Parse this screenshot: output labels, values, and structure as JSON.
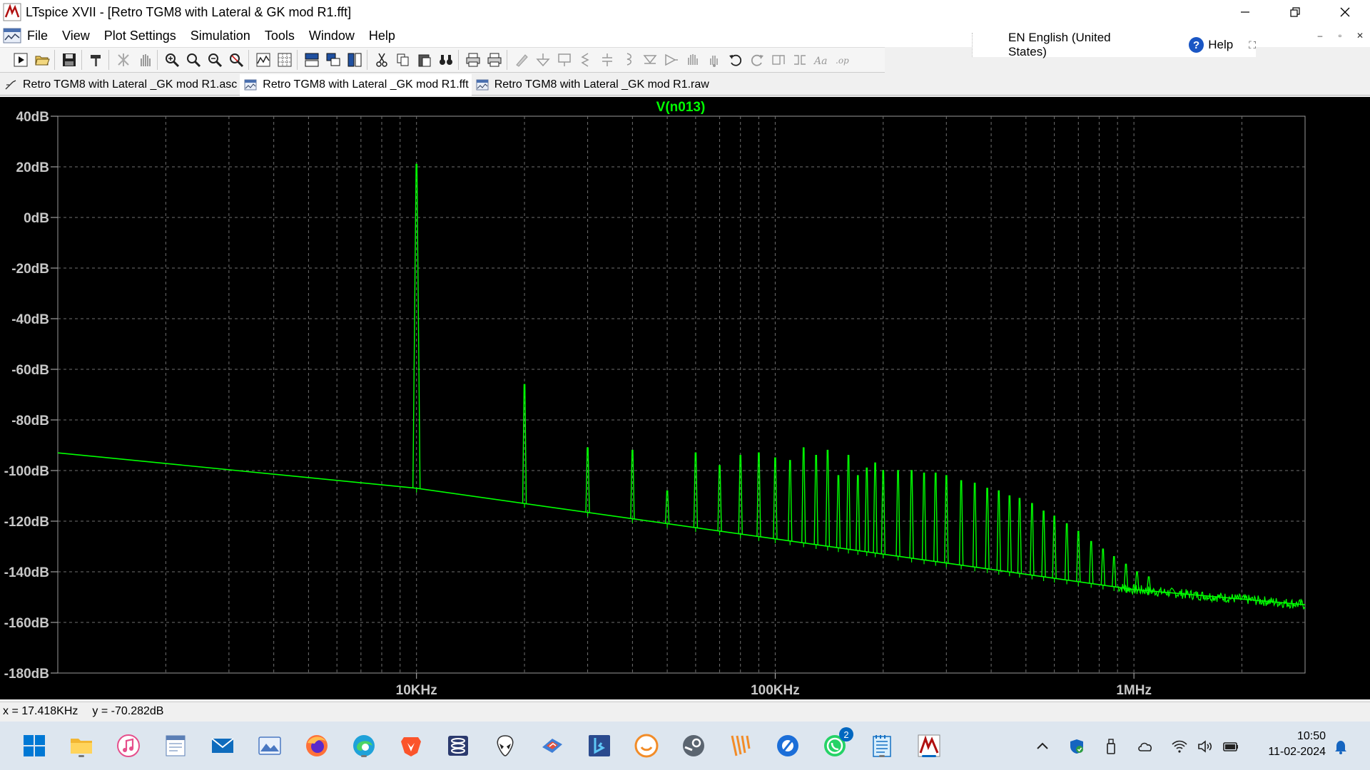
{
  "window": {
    "title": "LTspice XVII - [Retro TGM8 with Lateral & GK mod R1.fft]"
  },
  "menu": {
    "items": [
      "File",
      "View",
      "Plot Settings",
      "Simulation",
      "Tools",
      "Window",
      "Help"
    ]
  },
  "language_panel": {
    "language": "EN English (United States)",
    "help": "Help"
  },
  "tabs": [
    {
      "label": "Retro TGM8 with Lateral _GK mod R1.asc",
      "icon": "schematic-icon",
      "active": false
    },
    {
      "label": "Retro TGM8 with Lateral _GK mod R1.fft",
      "icon": "waveform-icon",
      "active": true
    },
    {
      "label": "Retro TGM8 with Lateral _GK mod R1.raw",
      "icon": "waveform-icon",
      "active": false
    }
  ],
  "status": {
    "x_readout": "x = 17.418KHz",
    "y_readout": "y = -70.282dB"
  },
  "clock": {
    "time": "10:50",
    "date": "11-02-2024"
  },
  "taskbar": {
    "whatsapp_badge": "2"
  },
  "chart_data": {
    "type": "line",
    "title": "V(n013)",
    "xlabel": "",
    "ylabel": "",
    "x_scale": "log",
    "xlim": [
      1000,
      3000000
    ],
    "ylim": [
      -180,
      40
    ],
    "x_ticks": [
      {
        "value": 10000,
        "label": "10KHz"
      },
      {
        "value": 100000,
        "label": "100KHz"
      },
      {
        "value": 1000000,
        "label": "1MHz"
      }
    ],
    "y_ticks": [
      {
        "value": 40,
        "label": "40dB"
      },
      {
        "value": 20,
        "label": "20dB"
      },
      {
        "value": 0,
        "label": "0dB"
      },
      {
        "value": -20,
        "label": "-20dB"
      },
      {
        "value": -40,
        "label": "-40dB"
      },
      {
        "value": -60,
        "label": "-60dB"
      },
      {
        "value": -80,
        "label": "-80dB"
      },
      {
        "value": -100,
        "label": "-100dB"
      },
      {
        "value": -120,
        "label": "-120dB"
      },
      {
        "value": -140,
        "label": "-140dB"
      },
      {
        "value": -160,
        "label": "-160dB"
      },
      {
        "value": -180,
        "label": "-180dB"
      }
    ],
    "grid": true,
    "series_color": "#00ff00",
    "noise_floor": [
      {
        "x": 1000,
        "y": -93
      },
      {
        "x": 10000,
        "y": -107
      },
      {
        "x": 100000,
        "y": -127
      },
      {
        "x": 1000000,
        "y": -147
      },
      {
        "x": 3000000,
        "y": -153
      }
    ],
    "harmonics": [
      {
        "x": 10000,
        "y": 21
      },
      {
        "x": 20000,
        "y": -66
      },
      {
        "x": 30000,
        "y": -91
      },
      {
        "x": 40000,
        "y": -92
      },
      {
        "x": 50000,
        "y": -108
      },
      {
        "x": 60000,
        "y": -93
      },
      {
        "x": 70000,
        "y": -98
      },
      {
        "x": 80000,
        "y": -94
      },
      {
        "x": 90000,
        "y": -93
      },
      {
        "x": 100000,
        "y": -95
      },
      {
        "x": 110000,
        "y": -96
      },
      {
        "x": 120000,
        "y": -91
      },
      {
        "x": 130000,
        "y": -94
      },
      {
        "x": 140000,
        "y": -92
      },
      {
        "x": 150000,
        "y": -102
      },
      {
        "x": 160000,
        "y": -94
      },
      {
        "x": 170000,
        "y": -102
      },
      {
        "x": 180000,
        "y": -99
      },
      {
        "x": 190000,
        "y": -97
      },
      {
        "x": 200000,
        "y": -100
      },
      {
        "x": 220000,
        "y": -100
      },
      {
        "x": 240000,
        "y": -100
      },
      {
        "x": 260000,
        "y": -101
      },
      {
        "x": 280000,
        "y": -101
      },
      {
        "x": 300000,
        "y": -102
      },
      {
        "x": 330000,
        "y": -104
      },
      {
        "x": 360000,
        "y": -105
      },
      {
        "x": 390000,
        "y": -107
      },
      {
        "x": 420000,
        "y": -108
      },
      {
        "x": 450000,
        "y": -110
      },
      {
        "x": 480000,
        "y": -111
      },
      {
        "x": 520000,
        "y": -113
      },
      {
        "x": 560000,
        "y": -116
      },
      {
        "x": 600000,
        "y": -118
      },
      {
        "x": 650000,
        "y": -121
      },
      {
        "x": 700000,
        "y": -124
      },
      {
        "x": 760000,
        "y": -128
      },
      {
        "x": 820000,
        "y": -131
      },
      {
        "x": 880000,
        "y": -134
      },
      {
        "x": 950000,
        "y": -137
      },
      {
        "x": 1020000,
        "y": -140
      },
      {
        "x": 1100000,
        "y": -142
      }
    ]
  }
}
